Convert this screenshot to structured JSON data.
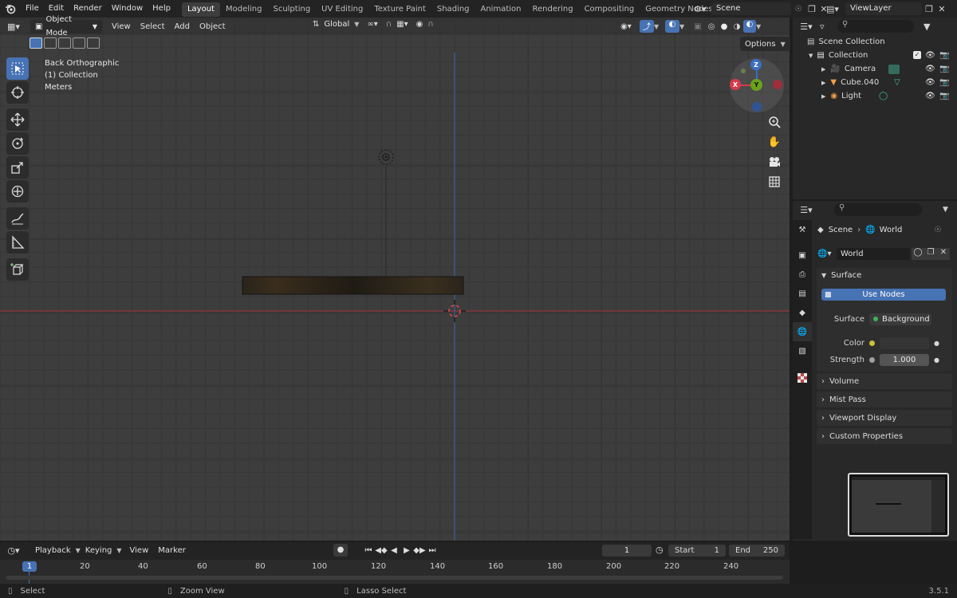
{
  "topbar": {
    "menus": [
      "File",
      "Edit",
      "Render",
      "Window",
      "Help"
    ],
    "workspaces": [
      "Layout",
      "Modeling",
      "Sculpting",
      "UV Editing",
      "Texture Paint",
      "Shading",
      "Animation",
      "Rendering",
      "Compositing",
      "Geometry Nodes"
    ],
    "active_workspace": "Layout",
    "scene_name": "Scene",
    "view_layer": "ViewLayer"
  },
  "viewport_header": {
    "mode": "Object Mode",
    "menus": [
      "View",
      "Select",
      "Add",
      "Object"
    ],
    "transform_orientation": "Global",
    "options_label": "Options"
  },
  "viewport_overlay": {
    "view_name": "Back Orthographic",
    "collection": "(1) Collection",
    "units": "Meters"
  },
  "gizmo": {
    "z": "Z",
    "x": "X",
    "y": "Y"
  },
  "outliner": {
    "root": "Scene Collection",
    "collection": "Collection",
    "items": [
      {
        "label": "Camera"
      },
      {
        "label": "Cube.040"
      },
      {
        "label": "Light"
      }
    ]
  },
  "properties": {
    "breadcrumb_scene": "Scene",
    "breadcrumb_world": "World",
    "world_name": "World",
    "surface_panel": "Surface",
    "use_nodes": "Use Nodes",
    "surface_label": "Surface",
    "surface_value": "Background",
    "color_label": "Color",
    "strength_label": "Strength",
    "strength_value": "1.000",
    "panels": [
      "Volume",
      "Mist Pass",
      "Viewport Display",
      "Custom Properties"
    ]
  },
  "timeline": {
    "menus": [
      "Playback",
      "Keying",
      "View",
      "Marker"
    ],
    "current_frame": "1",
    "start_label": "Start",
    "start_value": "1",
    "end_label": "End",
    "end_value": "250",
    "ruler": [
      "1",
      "20",
      "40",
      "60",
      "80",
      "100",
      "120",
      "140",
      "160",
      "180",
      "200",
      "220",
      "240"
    ]
  },
  "statusbar": {
    "select": "Select",
    "zoom_view": "Zoom View",
    "lasso_select": "Lasso Select",
    "version": "3.5.1"
  },
  "colors": {
    "accent": "#4772b3",
    "x_axis": "#d63a4b",
    "y_axis": "#6aa31a",
    "z_axis": "#3a6ec5"
  }
}
